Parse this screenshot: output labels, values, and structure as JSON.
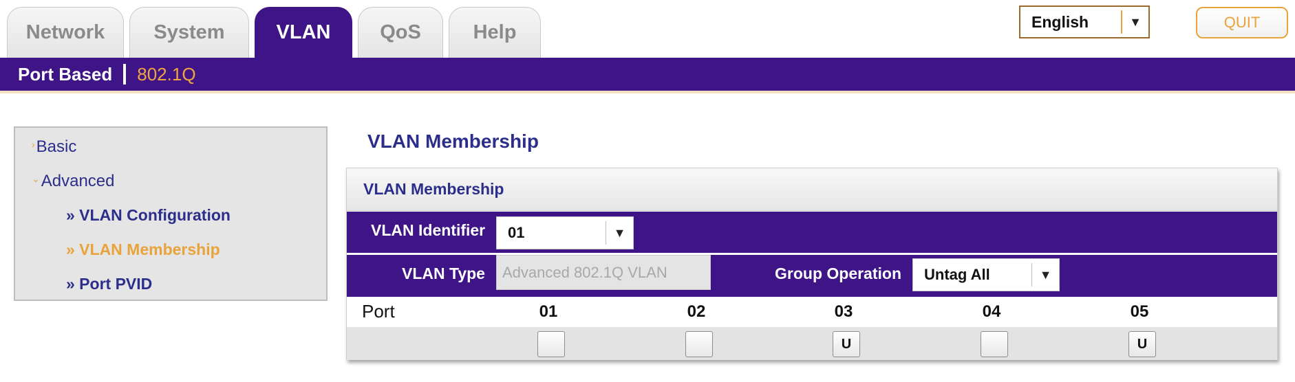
{
  "tabs": [
    {
      "label": "Network",
      "active": false
    },
    {
      "label": "System",
      "active": false
    },
    {
      "label": "VLAN",
      "active": true
    },
    {
      "label": "QoS",
      "active": false
    },
    {
      "label": "Help",
      "active": false
    }
  ],
  "language": {
    "selected": "English",
    "arrow": "▼"
  },
  "quit_label": "QUIT",
  "subnav": {
    "port_based": "Port Based",
    "dot1q": "802.1Q"
  },
  "sidebar": {
    "chev_right": "›",
    "chev_down": "⌄",
    "basic": "Basic",
    "advanced": "Advanced",
    "items": [
      {
        "label": "» VLAN Configuration",
        "active": false
      },
      {
        "label": "» VLAN Membership",
        "active": true
      },
      {
        "label": "» Port PVID",
        "active": false
      }
    ]
  },
  "page_title": "VLAN Membership",
  "panel": {
    "title": "VLAN Membership",
    "vlan_identifier_label": "VLAN Identifier",
    "vlan_identifier_value": "01",
    "vlan_type_label": "VLAN Type",
    "vlan_type_value": "Advanced 802.1Q VLAN",
    "group_operation_label": "Group Operation",
    "group_operation_value": "Untag All",
    "port_label": "Port",
    "ports": [
      {
        "num": "01",
        "state": ""
      },
      {
        "num": "02",
        "state": ""
      },
      {
        "num": "03",
        "state": "U"
      },
      {
        "num": "04",
        "state": ""
      },
      {
        "num": "05",
        "state": "U"
      }
    ]
  },
  "colors": {
    "brand_purple": "#3f1486",
    "accent_orange": "#e8a33a",
    "link_blue": "#2b2e8a"
  }
}
